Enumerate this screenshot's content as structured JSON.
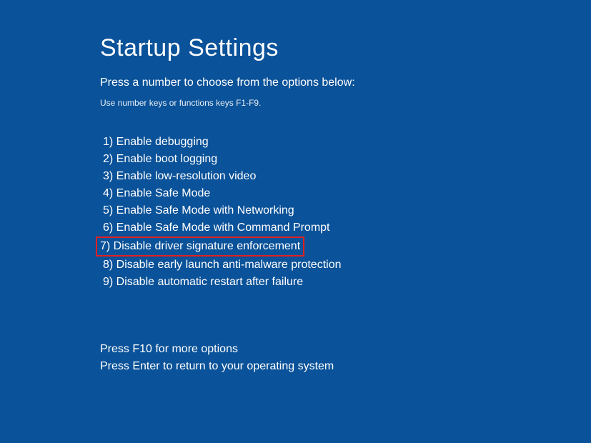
{
  "title": "Startup Settings",
  "subtitle": "Press a number to choose from the options below:",
  "hint": "Use number keys or functions keys F1-F9.",
  "options": [
    {
      "num": "1",
      "label": "Enable debugging",
      "highlighted": false
    },
    {
      "num": "2",
      "label": "Enable boot logging",
      "highlighted": false
    },
    {
      "num": "3",
      "label": "Enable low-resolution video",
      "highlighted": false
    },
    {
      "num": "4",
      "label": "Enable Safe Mode",
      "highlighted": false
    },
    {
      "num": "5",
      "label": "Enable Safe Mode with Networking",
      "highlighted": false
    },
    {
      "num": "6",
      "label": "Enable Safe Mode with Command Prompt",
      "highlighted": false
    },
    {
      "num": "7",
      "label": "Disable driver signature enforcement",
      "highlighted": true
    },
    {
      "num": "8",
      "label": "Disable early launch anti-malware protection",
      "highlighted": false
    },
    {
      "num": "9",
      "label": "Disable automatic restart after failure",
      "highlighted": false
    }
  ],
  "footer": {
    "line1": "Press F10 for more options",
    "line2": "Press Enter to return to your operating system"
  }
}
